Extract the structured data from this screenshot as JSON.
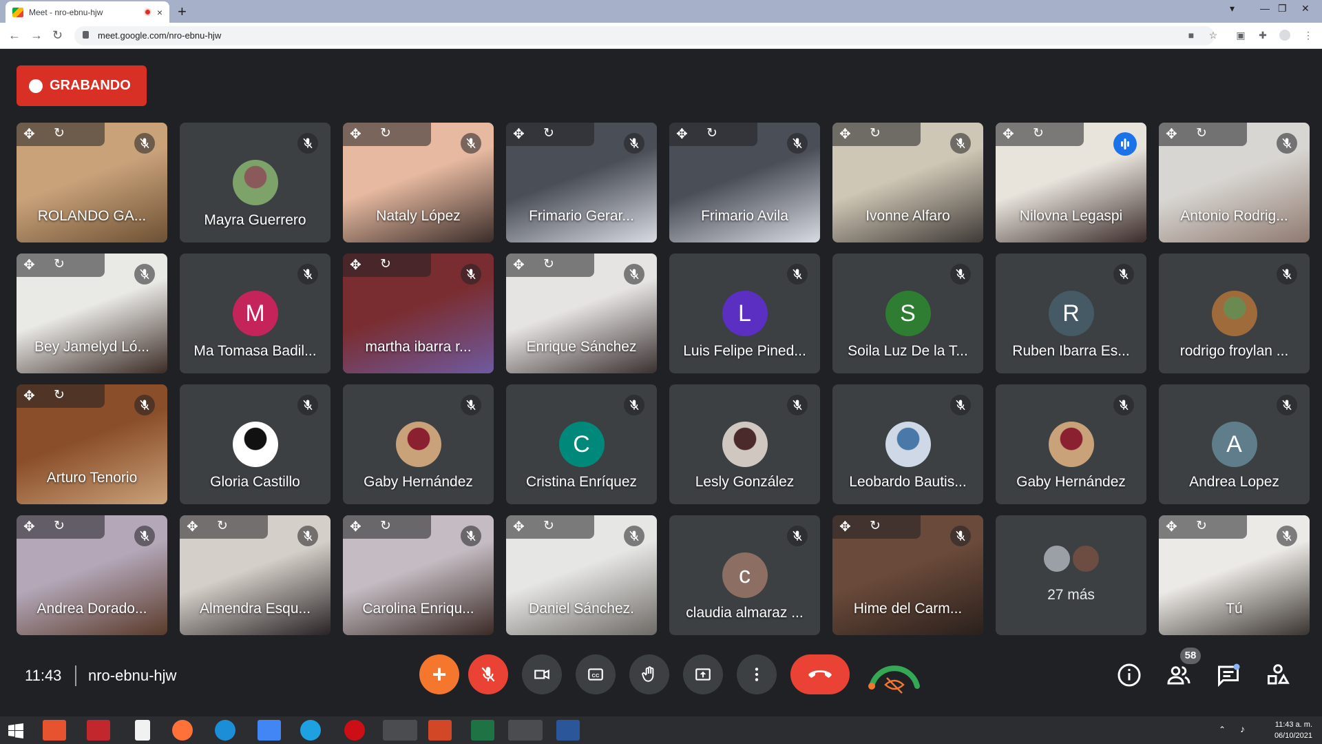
{
  "browser": {
    "tab_title": "Meet - nro-ebnu-hjw",
    "new_tab": "+",
    "close_tab": "×",
    "url": "meet.google.com/nro-ebnu-hjw"
  },
  "recording": {
    "label": "GRABANDO"
  },
  "participants": [
    {
      "name": "ROLANDO GA...",
      "type": "video",
      "colors": [
        "#c9a27a",
        "#6d5134"
      ]
    },
    {
      "name": "Mayra Guerrero",
      "type": "photo",
      "colors": [
        "#7ea36a",
        "#8a5a5a"
      ]
    },
    {
      "name": "Nataly López",
      "type": "video",
      "colors": [
        "#e6b9a0",
        "#3a2d2a"
      ]
    },
    {
      "name": "Frimario Gerar...",
      "type": "video",
      "colors": [
        "#4a4e57",
        "#d8dbe2"
      ]
    },
    {
      "name": "Frimario Avila",
      "type": "video",
      "colors": [
        "#4a4e57",
        "#d8dbe2"
      ]
    },
    {
      "name": "Ivonne Alfaro",
      "type": "video",
      "colors": [
        "#cfc7b5",
        "#3f3a37"
      ]
    },
    {
      "name": "Nilovna Legaspi",
      "type": "video",
      "speaking": true,
      "colors": [
        "#e8e4dc",
        "#3a2b2a"
      ]
    },
    {
      "name": "Antonio Rodrig...",
      "type": "video",
      "colors": [
        "#d8d6d2",
        "#8f7a70"
      ]
    },
    {
      "name": "Bey Jamelyd Ló...",
      "type": "video",
      "colors": [
        "#e9e9e6",
        "#3b2b25"
      ]
    },
    {
      "name": "Ma Tomasa Badil...",
      "type": "letter",
      "letter": "M",
      "colors": [
        "#c5245a"
      ]
    },
    {
      "name": "martha ibarra r...",
      "type": "video",
      "colors": [
        "#7a2d30",
        "#6e5aa0"
      ]
    },
    {
      "name": "Enrique Sánchez",
      "type": "video",
      "colors": [
        "#e6e4e2",
        "#3a3030"
      ]
    },
    {
      "name": "Luis Felipe Pined...",
      "type": "letter",
      "letter": "L",
      "colors": [
        "#5a2fc2"
      ]
    },
    {
      "name": "Soila Luz De la T...",
      "type": "letter",
      "letter": "S",
      "colors": [
        "#2e7d32"
      ]
    },
    {
      "name": "Ruben Ibarra Es...",
      "type": "letter",
      "letter": "R",
      "colors": [
        "#455a64"
      ]
    },
    {
      "name": "rodrigo froylan ...",
      "type": "photo",
      "colors": [
        "#a06b3a",
        "#6b8a52"
      ]
    },
    {
      "name": "Arturo Tenorio",
      "type": "video",
      "colors": [
        "#8a4e2a",
        "#c9a27a"
      ]
    },
    {
      "name": "Gloria Castillo",
      "type": "photo",
      "colors": [
        "#ffffff",
        "#111111"
      ]
    },
    {
      "name": "Gaby Hernández",
      "type": "photo",
      "colors": [
        "#c9a27a",
        "#8a2030"
      ]
    },
    {
      "name": "Cristina Enríquez",
      "type": "letter",
      "letter": "C",
      "colors": [
        "#00897b"
      ]
    },
    {
      "name": "Lesly González",
      "type": "photo",
      "colors": [
        "#cfc7c0",
        "#4a2a2a"
      ]
    },
    {
      "name": "Leobardo Bautis...",
      "type": "photo",
      "colors": [
        "#cfd8e6",
        "#4a78a8"
      ]
    },
    {
      "name": "Gaby Hernández",
      "type": "photo",
      "colors": [
        "#c9a27a",
        "#8a2030"
      ]
    },
    {
      "name": "Andrea Lopez",
      "type": "letter",
      "letter": "A",
      "colors": [
        "#607d8b"
      ]
    },
    {
      "name": "Andrea Dorado...",
      "type": "video",
      "colors": [
        "#b3a7b8",
        "#5a3a2a"
      ]
    },
    {
      "name": "Almendra Esqu...",
      "type": "video",
      "colors": [
        "#d4cfc8",
        "#2a2326"
      ]
    },
    {
      "name": "Carolina Enriqu...",
      "type": "video",
      "colors": [
        "#c4bcc2",
        "#3a2a26"
      ]
    },
    {
      "name": "Daniel Sánchez.",
      "type": "video",
      "colors": [
        "#e6e6e4",
        "#6e6a66"
      ]
    },
    {
      "name": "claudia almaraz ...",
      "type": "letter",
      "letter": "c",
      "colors": [
        "#8d6e63"
      ]
    },
    {
      "name": "Hime del Carm...",
      "type": "video",
      "colors": [
        "#6a4a3a",
        "#2a201c"
      ]
    },
    {
      "name": "27 más",
      "type": "more"
    },
    {
      "name": "Tú",
      "type": "video",
      "self": true,
      "colors": [
        "#eceae6",
        "#3a3430"
      ]
    }
  ],
  "bottom_bar": {
    "time": "11:43",
    "meeting_code": "nro-ebnu-hjw",
    "participants_count": "58"
  },
  "taskbar": {
    "time": "11:43 a. m.",
    "date": "06/10/2021"
  },
  "icons": {
    "mute": "microphone-off-icon",
    "move": "move-icon",
    "refresh": "refresh-icon",
    "speaking": "audio-bars-icon"
  },
  "colors": {
    "background": "#202124",
    "tile": "#3c4043",
    "recording_red": "#d93025",
    "hangup_red": "#ea4335",
    "speaking_outline": "#8ab4f8"
  }
}
